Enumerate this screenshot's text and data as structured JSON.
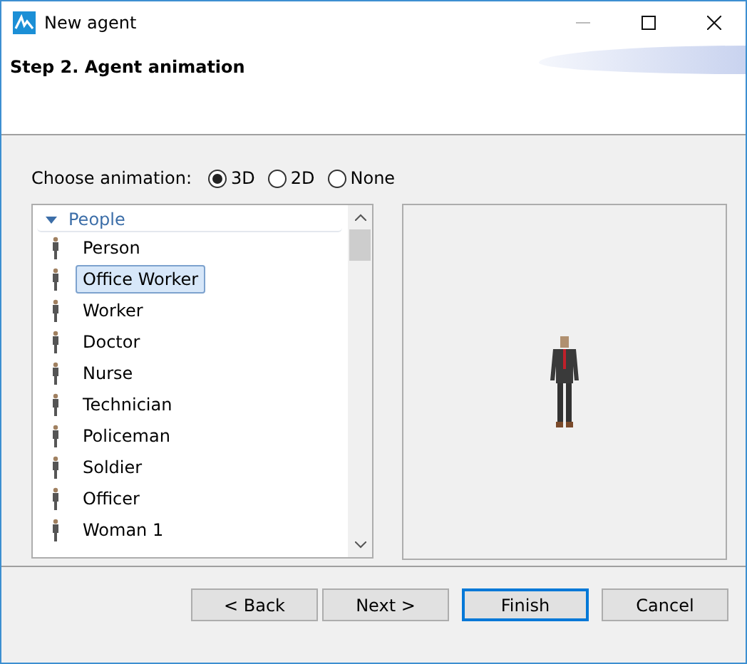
{
  "window": {
    "title": "New agent"
  },
  "header": {
    "title": "Step 2. Agent animation"
  },
  "animation": {
    "label": "Choose animation:",
    "options": [
      {
        "label": "3D",
        "selected": true
      },
      {
        "label": "2D",
        "selected": false
      },
      {
        "label": "None",
        "selected": false
      }
    ]
  },
  "tree": {
    "group": {
      "label": "People",
      "expanded": true
    },
    "items": [
      {
        "label": "Person",
        "selected": false
      },
      {
        "label": "Office Worker",
        "selected": true
      },
      {
        "label": "Worker",
        "selected": false
      },
      {
        "label": "Doctor",
        "selected": false
      },
      {
        "label": "Nurse",
        "selected": false
      },
      {
        "label": "Technician",
        "selected": false
      },
      {
        "label": "Policeman",
        "selected": false
      },
      {
        "label": "Soldier",
        "selected": false
      },
      {
        "label": "Officer",
        "selected": false
      },
      {
        "label": "Woman 1",
        "selected": false
      }
    ]
  },
  "buttons": [
    {
      "label": "< Back",
      "default": false
    },
    {
      "label": "Next >",
      "default": false
    },
    {
      "label": "Finish",
      "default": true
    },
    {
      "label": "Cancel",
      "default": false
    }
  ]
}
